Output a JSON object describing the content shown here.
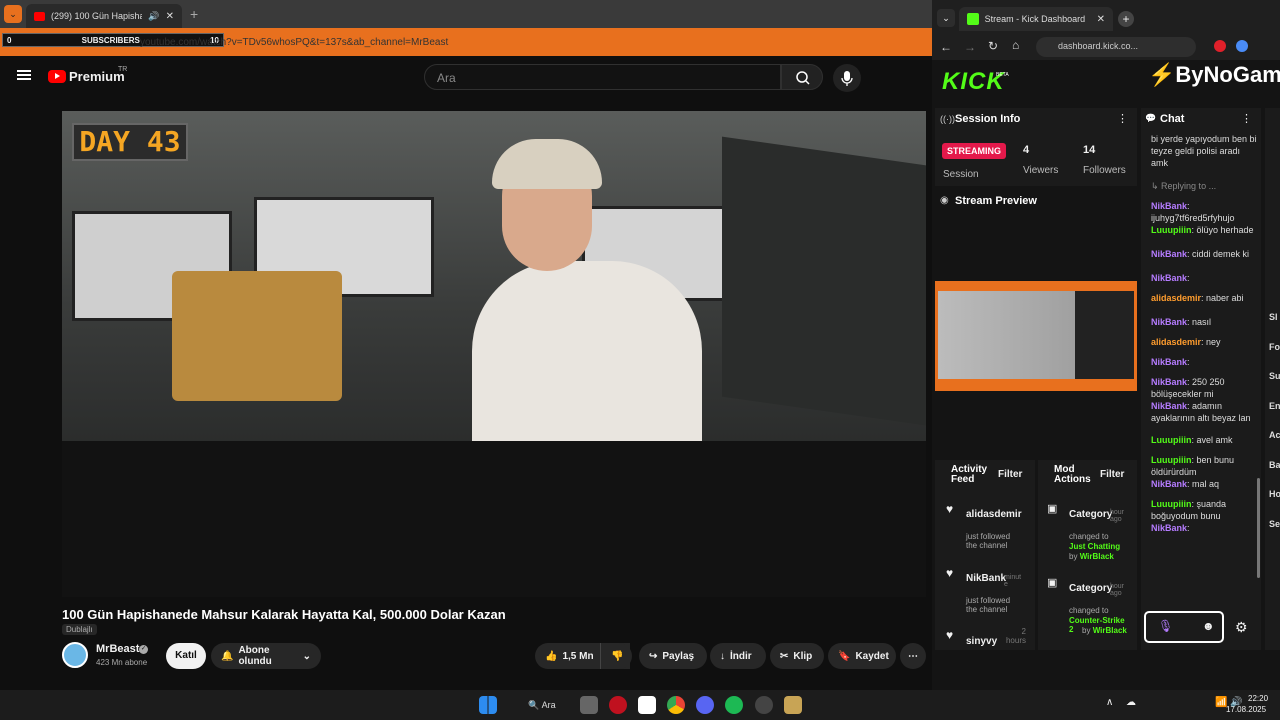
{
  "yt_browser": {
    "tab_title": "(299) 100 Gün Hapishanede",
    "address": "youtube.com/watch?v=TDv56whosPQ&t=137s&ab_channel=MrBeast",
    "subscriber_overlay": {
      "left": "0",
      "label": "SUBSCRIBERS",
      "right": "10"
    }
  },
  "youtube": {
    "logo": "Premium",
    "logo_sup": "TR",
    "search_placeholder": "Ara",
    "video_overlay_text": "DAY 43",
    "video_title": "100 Gün Hapishanede Mahsur Kalarak Hayatta Kal, 500.000 Dolar Kazan",
    "dub_label": "Dublajlı",
    "channel_name": "MrBeast",
    "subscribers": "423 Mn abone",
    "join_label": "Katıl",
    "subscribed_label": "Abone olundu",
    "likes": "1,5 Mn",
    "share_label": "Paylaş",
    "download_label": "İndir",
    "clip_label": "Klip",
    "save_label": "Kaydet"
  },
  "kick_browser": {
    "tab_title": "Stream - Kick Dashboard",
    "address": "dashboard.kick.co..."
  },
  "kick": {
    "logo": "KICK",
    "logo_sup": "BETA",
    "brand": "ByNoGame",
    "session_title": "Session Info",
    "streaming_badge": "STREAMING",
    "session_label": "Session",
    "viewers_count": "4",
    "viewers_label": "Viewers",
    "followers_count": "14",
    "followers_label": "Followers",
    "preview_title": "Stream Preview",
    "activity_title": "Activity Feed",
    "activity_filter": "Filter",
    "activity": [
      {
        "user": "alidasdemir",
        "time": "",
        "text": "just followed the channel"
      },
      {
        "user": "NikBank",
        "time": "minut e",
        "text": "just followed the channel"
      },
      {
        "user": "sinyvy",
        "time": "2 hours",
        "text": ""
      }
    ],
    "mod_title": "Mod Actions",
    "mod_filter": "Filter",
    "mod": [
      {
        "title": "Category",
        "time": "hour ago",
        "prefix": "changed to",
        "value": "Just Chatting",
        "by": "by",
        "user": "WirBlack"
      },
      {
        "title": "Category",
        "time": "hour ago",
        "prefix": "changed to",
        "value": "Counter-Strike 2",
        "by": "by",
        "user": "WirBlack"
      }
    ],
    "chat_title": "Chat",
    "chat": [
      {
        "user": "",
        "cls": "",
        "text": "bi yerde yapıyodum ben bi teyze geldi polisi aradı amk"
      },
      {
        "user": "",
        "cls": "",
        "text": "↳ Replying to ..."
      },
      {
        "user": "NikBank",
        "cls": "nk",
        "text": ": ijuhyg7tf6red5rfyhujo"
      },
      {
        "user": "Luuupiiin",
        "cls": "lu",
        "text": ": ölüyo herhade"
      },
      {
        "user": "NikBank",
        "cls": "nk",
        "text": ": ciddi demek ki"
      },
      {
        "user": "NikBank",
        "cls": "nk",
        "text": ":"
      },
      {
        "user": "alidasdemir",
        "cls": "al",
        "text": ": naber abi"
      },
      {
        "user": "NikBank",
        "cls": "nk",
        "text": ": nasıl"
      },
      {
        "user": "alidasdemir",
        "cls": "al",
        "text": ": ney"
      },
      {
        "user": "NikBank",
        "cls": "nk",
        "text": ":"
      },
      {
        "user": "NikBank",
        "cls": "nk",
        "text": ": 250 250 bölüşecekler mi"
      },
      {
        "user": "NikBank",
        "cls": "nk",
        "text": ": adamın ayaklarının altı beyaz lan"
      },
      {
        "user": "Luuupiiin",
        "cls": "lu",
        "text": ": avel amk"
      },
      {
        "user": "Luuupiiin",
        "cls": "lu",
        "text": ": ben bunu öldürürdüm"
      },
      {
        "user": "NikBank",
        "cls": "nk",
        "text": ": mal aq"
      },
      {
        "user": "Luuupiiin",
        "cls": "lu",
        "text": ": şuanda boğuyodum bunu"
      },
      {
        "user": "NikBank",
        "cls": "nk",
        "text": ":"
      }
    ],
    "side_letters": [
      "Sl",
      "Fo",
      "Su",
      "En",
      "Ac",
      "Ba",
      "Ho",
      "Se"
    ]
  },
  "taskbar": {
    "search_label": "Ara",
    "time": "22:20",
    "date": "17.08.2025"
  }
}
